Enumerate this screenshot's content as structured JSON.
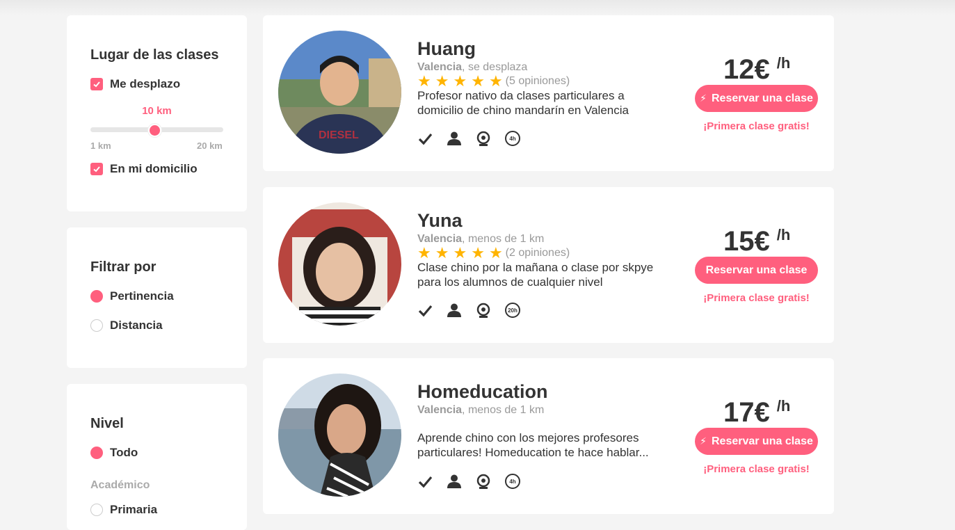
{
  "filters": {
    "location": {
      "title": "Lugar de las clases",
      "travel_label": "Me desplazo",
      "distance_value": "10 km",
      "distance_min": "1 km",
      "distance_max": "20 km",
      "distance_level": 0.47,
      "home_label": "En mi domicilio"
    },
    "sort": {
      "title": "Filtrar por",
      "options": [
        "Pertinencia",
        "Distancia"
      ],
      "selected": "Pertinencia"
    },
    "level": {
      "title": "Nivel",
      "options": [
        "Todo",
        "Primaria"
      ],
      "group_label": "Académico",
      "selected": "Todo"
    }
  },
  "teachers": [
    {
      "name": "Huang",
      "city": "Valencia",
      "distance": ", se desplaza",
      "stars": 5,
      "reviews": "(5 opiniones)",
      "description": "Profesor nativo da clases particulares a domicilio de chino mandarín en Valencia",
      "hours_badge": "4h",
      "price": "12€",
      "price_unit": "/h",
      "book_label": "Reservar una clase",
      "instant_book": true,
      "promo": "¡Primera clase gratis!"
    },
    {
      "name": "Yuna",
      "city": "Valencia",
      "distance": ", menos de 1 km",
      "stars": 5,
      "reviews": "(2 opiniones)",
      "description": "Clase chino por la mañana o clase por skpye para los alumnos de cualquier nivel",
      "hours_badge": "20h",
      "price": "15€",
      "price_unit": "/h",
      "book_label": "Reservar una clase",
      "instant_book": false,
      "promo": "¡Primera clase gratis!"
    },
    {
      "name": "Homeducation",
      "city": "Valencia",
      "distance": ", menos de 1 km",
      "stars": 0,
      "reviews": "",
      "description": "Aprende chino con los mejores profesores particulares! Homeducation te hace hablar...",
      "hours_badge": "4h",
      "price": "17€",
      "price_unit": "/h",
      "book_label": "Reservar una clase",
      "instant_book": true,
      "promo": "¡Primera clase gratis!"
    }
  ],
  "icons": [
    "check-icon",
    "person-icon",
    "webcam-icon",
    "hours-icon",
    "star-icon",
    "bolt-icon"
  ],
  "colors": {
    "accent": "#ff5f7e",
    "star": "#ffb400",
    "muted": "#999999",
    "background": "#f4f4f4"
  }
}
